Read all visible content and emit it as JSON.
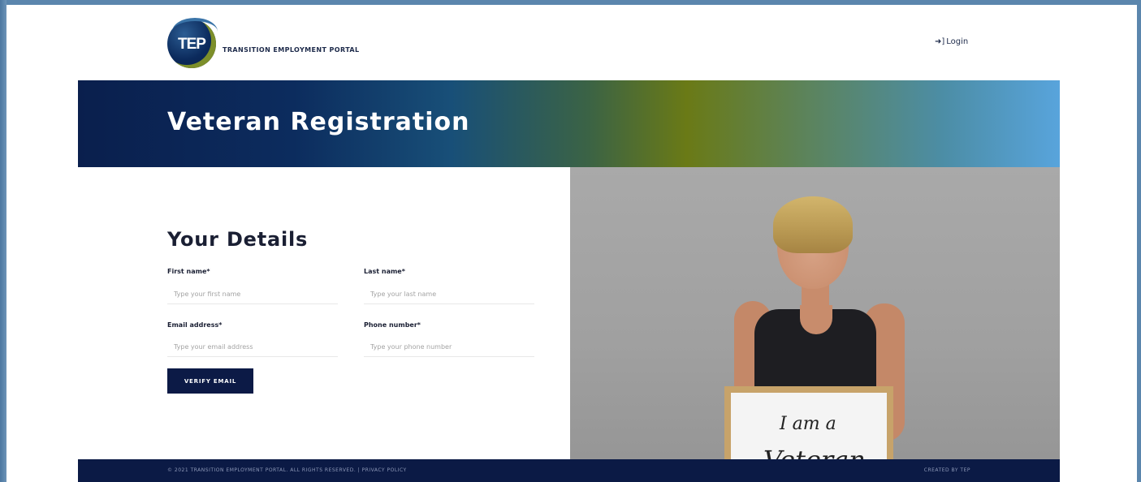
{
  "header": {
    "logo_text": "TEP",
    "site_name": "TRANSITION EMPLOYMENT PORTAL",
    "login_label": "Login",
    "login_icon": "login-icon"
  },
  "banner": {
    "title": "Veteran Registration"
  },
  "form": {
    "section_title": "Your Details",
    "fields": {
      "first_name": {
        "label": "First name*",
        "placeholder": "Type your first name"
      },
      "last_name": {
        "label": "Last name*",
        "placeholder": "Type your last name"
      },
      "email": {
        "label": "Email address*",
        "placeholder": "Type your email address"
      },
      "phone": {
        "label": "Phone number*",
        "placeholder": "Type your phone number"
      }
    },
    "verify_button": "VERIFY EMAIL"
  },
  "photo": {
    "sign_line1": "I am a",
    "sign_line2": "Veteran"
  },
  "footer": {
    "left_text": "© 2021 TRANSITION EMPLOYMENT PORTAL. ALL RIGHTS RESERVED.  |  PRIVACY POLICY",
    "right_text": "CREATED BY TEP"
  },
  "colors": {
    "primary": "#0c1a46",
    "banner_start": "#0a1f4d",
    "banner_end": "#58a4dc"
  }
}
